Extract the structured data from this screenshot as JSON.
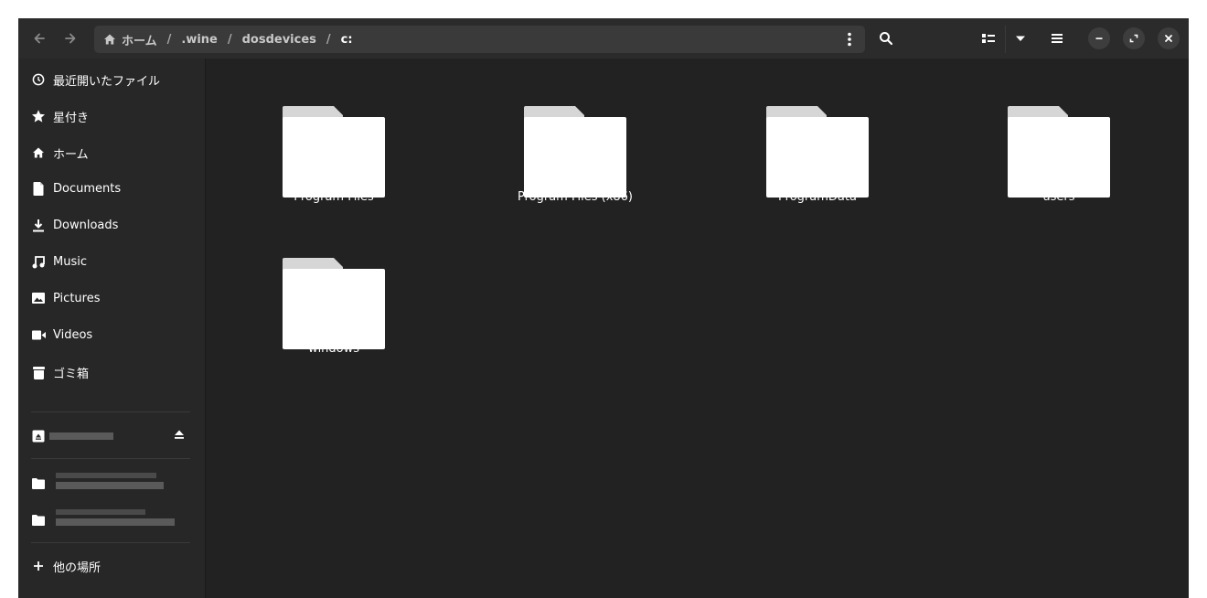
{
  "header": {
    "path": {
      "home_label": "ホーム",
      "segments": [
        ".wine",
        "dosdevices"
      ],
      "current": "c:",
      "separator": "/"
    }
  },
  "sidebar": {
    "items": [
      {
        "label": "最近開いたファイル",
        "icon": "clock-icon"
      },
      {
        "label": "星付き",
        "icon": "star-icon"
      },
      {
        "label": "ホーム",
        "icon": "home-icon"
      },
      {
        "label": "Documents",
        "icon": "document-icon"
      },
      {
        "label": "Downloads",
        "icon": "download-icon"
      },
      {
        "label": "Music",
        "icon": "music-icon"
      },
      {
        "label": "Pictures",
        "icon": "picture-icon"
      },
      {
        "label": "Videos",
        "icon": "video-icon"
      },
      {
        "label": "ゴミ箱",
        "icon": "trash-icon"
      }
    ],
    "other_locations": "他の場所"
  },
  "files": [
    {
      "name": "Program Files"
    },
    {
      "name": "Program Files (x86)"
    },
    {
      "name": "ProgramData"
    },
    {
      "name": "users"
    },
    {
      "name": "windows"
    }
  ],
  "colors": {
    "window_bg": "#222222",
    "sidebar_bg": "#272727",
    "header_bg": "#2b2b2b",
    "pathbar_bg": "#3a3a3a",
    "folder_body": "#ffffff",
    "folder_tab": "#d6d6d6"
  }
}
